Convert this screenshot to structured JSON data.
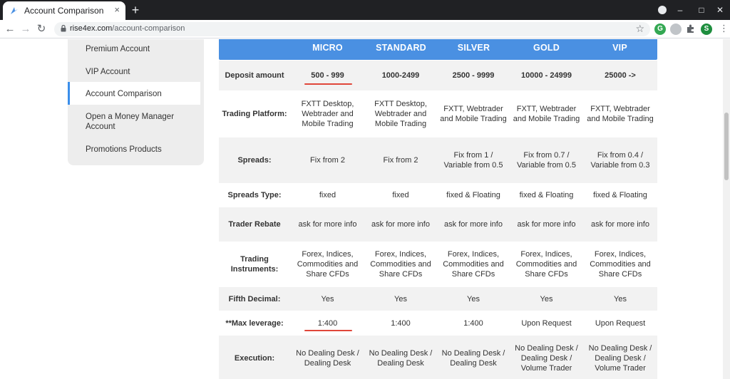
{
  "browser": {
    "tab_title": "Account Comparison",
    "tab_close": "×",
    "new_tab": "+",
    "url_host": "rise4ex.com",
    "url_path": "/account-comparison",
    "back": "←",
    "forward": "→",
    "reload": "↻",
    "bookmark": "☆",
    "profile_letter": "S",
    "minimize": "–",
    "maximize": "□",
    "close": "✕"
  },
  "sidebar": {
    "items": [
      {
        "label": "Premium Account"
      },
      {
        "label": "VIP Account"
      },
      {
        "label": "Account Comparison"
      },
      {
        "label": "Open a Money Manager Account"
      },
      {
        "label": "Promotions Products"
      }
    ]
  },
  "table": {
    "headers": [
      "MICRO",
      "STANDARD",
      "SILVER",
      "GOLD",
      "VIP"
    ],
    "rows": [
      {
        "label": "Deposit amount",
        "cells": [
          "500 - 999",
          "1000-2499",
          "2500 - 9999",
          "10000 - 24999",
          "25000 ->"
        ]
      },
      {
        "label": "Trading Platform:",
        "cells": [
          "FXTT Desktop, Webtrader and Mobile Trading",
          "FXTT Desktop, Webtrader and Mobile Trading",
          "FXTT, Webtrader and Mobile Trading",
          "FXTT, Webtrader and Mobile Trading",
          "FXTT, Webtrader and Mobile Trading"
        ]
      },
      {
        "label": "Spreads:",
        "cells": [
          "Fix from 2",
          "Fix from 2",
          "Fix from 1 / Variable from 0.5",
          "Fix from 0.7 / Variable from 0.5",
          "Fix from 0.4 / Variable from 0.3"
        ]
      },
      {
        "label": "Spreads Type:",
        "cells": [
          "fixed",
          "fixed",
          "fixed & Floating",
          "fixed & Floating",
          "fixed & Floating"
        ]
      },
      {
        "label": "Trader Rebate",
        "cells": [
          "ask for more info",
          "ask for more info",
          "ask for more info",
          "ask for more info",
          "ask for more info"
        ]
      },
      {
        "label": "Trading Instruments:",
        "cells": [
          "Forex, Indices, Commodities and Share CFDs",
          "Forex, Indices, Commodities and Share CFDs",
          "Forex, Indices, Commodities and Share CFDs",
          "Forex, Indices, Commodities and Share CFDs",
          "Forex, Indices, Commodities and Share CFDs"
        ]
      },
      {
        "label": "Fifth Decimal:",
        "cells": [
          "Yes",
          "Yes",
          "Yes",
          "Yes",
          "Yes"
        ]
      },
      {
        "label": "**Max leverage:",
        "cells": [
          "1:400",
          "1:400",
          "1:400",
          "Upon Request",
          "Upon Request"
        ]
      },
      {
        "label": "Execution:",
        "cells": [
          "No Dealing Desk / Dealing Desk",
          "No Dealing Desk / Dealing Desk",
          "No Dealing Desk / Dealing Desk",
          "No Dealing Desk / Dealing Desk / Volume Trader",
          "No Dealing Desk / Dealing Desk / Volume Trader"
        ]
      }
    ]
  },
  "colors": {
    "header_blue": "#4a90e2",
    "highlight_red": "#e0463a",
    "active_border": "#3b8eea"
  }
}
